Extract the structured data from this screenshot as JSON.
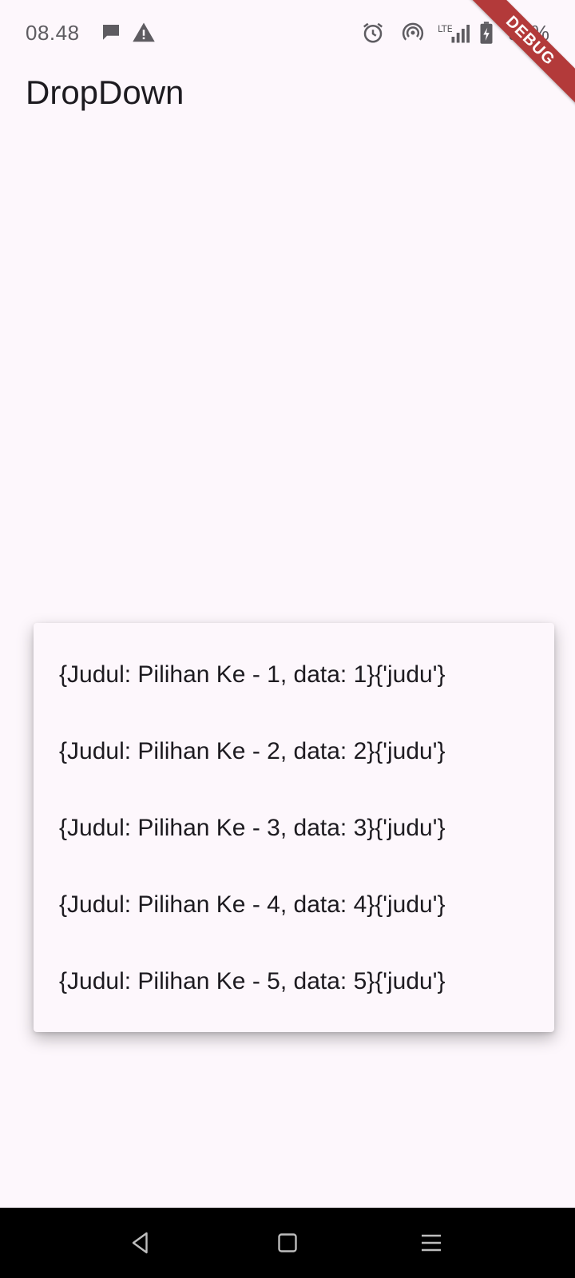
{
  "status_bar": {
    "time": "08.48",
    "battery_text": "94%",
    "icons": [
      "chat-bubble-icon",
      "warning-icon",
      "alarm-icon",
      "hotspot-icon",
      "lte-signal-icon",
      "battery-charging-icon"
    ]
  },
  "debug_banner": "DEBUG",
  "app_bar": {
    "title": "DropDown"
  },
  "dropdown": {
    "items": [
      {
        "label": "{Judul: Pilihan Ke - 1, data: 1}{'judu'}"
      },
      {
        "label": "{Judul: Pilihan Ke - 2, data: 2}{'judu'}"
      },
      {
        "label": "{Judul: Pilihan Ke - 3, data: 3}{'judu'}"
      },
      {
        "label": "{Judul: Pilihan Ke - 4, data: 4}{'judu'}"
      },
      {
        "label": "{Judul: Pilihan Ke - 5, data: 5}{'judu'}"
      }
    ]
  },
  "nav_bar": {
    "icons": [
      "back-icon",
      "home-icon",
      "recents-icon"
    ]
  },
  "colors": {
    "background": "#fdf7fc",
    "text": "#1d1b20",
    "status_text": "#5e5c61",
    "debug_ribbon": "#b33a3a",
    "nav_bar": "#000000"
  }
}
